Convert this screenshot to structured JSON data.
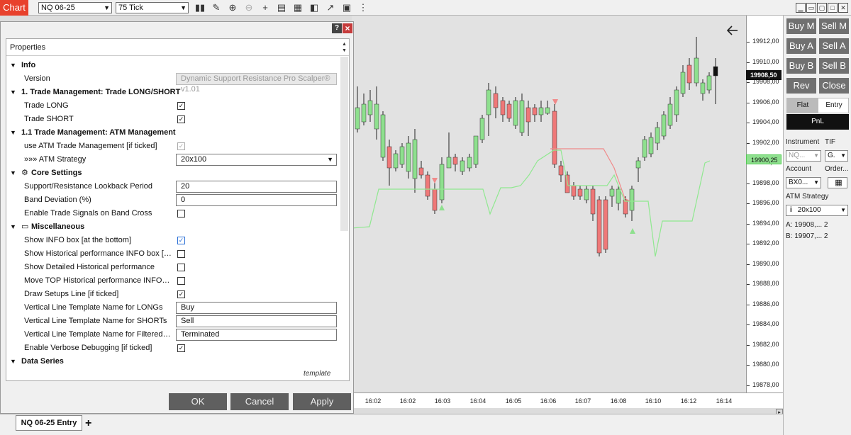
{
  "toolbar": {
    "chart_label": "Chart",
    "instrument": "NQ 06-25",
    "interval": "75 Tick"
  },
  "chart": {
    "price_label": "19908,50",
    "atm_price_label": "19900,25",
    "y_ticks": [
      "19912,00",
      "19910,00",
      "19908,00",
      "19906,00",
      "19904,00",
      "19902,00",
      "19900,00",
      "19898,00",
      "19896,00",
      "19894,00",
      "19892,00",
      "19890,00",
      "19888,00",
      "19886,00",
      "19884,00",
      "19882,00",
      "19880,00",
      "19878,00"
    ],
    "x_ticks": [
      "16:02",
      "16:02",
      "16:03",
      "16:04",
      "16:05",
      "16:06",
      "16:07",
      "16:08",
      "16:10",
      "16:12",
      "16:14"
    ],
    "colors": {
      "up": "#8ee08e",
      "down": "#ef7878",
      "support": "#90e890",
      "resistance": "#f08a8a"
    }
  },
  "right_panel": {
    "buy_mkt": "Buy M",
    "sell_mkt": "Sell M",
    "buy_ask": "Buy A",
    "sell_ask": "Sell A",
    "buy_bid": "Buy B",
    "sell_bid": "Sell B",
    "rev": "Rev",
    "close": "Close",
    "flat": "Flat",
    "entry": "Entry",
    "pnl": "PnL",
    "instrument_label": "Instrument",
    "tif_label": "TIF",
    "instrument_value": "NQ...",
    "tif_value": "G.",
    "account_label": "Account",
    "order_label": "Order...",
    "account_value": "BX0...",
    "atm_label": "ATM Strategy",
    "atm_value": "20x100",
    "ask_line": "A:  19908,...  2",
    "bid_line": "B:  19907,...  2"
  },
  "dialog": {
    "properties_header": "Properties",
    "template_label": "template",
    "ok": "OK",
    "cancel": "Cancel",
    "apply": "Apply",
    "help": "?",
    "rows": [
      {
        "type": "cat",
        "label": "Info"
      },
      {
        "type": "text",
        "label": "Version",
        "value": "Dynamic Support Resistance Pro Scalper® v1.01",
        "disabled": true
      },
      {
        "type": "cat",
        "label": "1. Trade Management: Trade LONG/SHORT"
      },
      {
        "type": "check",
        "label": "Trade LONG",
        "checked": true
      },
      {
        "type": "check",
        "label": "Trade SHORT",
        "checked": true
      },
      {
        "type": "cat",
        "label": "1.1 Trade Management: ATM Management"
      },
      {
        "type": "check",
        "label": "use ATM Trade Management [if ticked]",
        "checked": true,
        "disabled": true
      },
      {
        "type": "select",
        "label": "»»» ATM Strategy",
        "value": "20x100"
      },
      {
        "type": "cat",
        "label": "Core Settings",
        "icon": "gear"
      },
      {
        "type": "text",
        "label": "Support/Resistance Lookback Period",
        "value": "20"
      },
      {
        "type": "text",
        "label": "Band Deviation (%)",
        "value": "0"
      },
      {
        "type": "check",
        "label": "Enable Trade Signals on Band Cross",
        "checked": false
      },
      {
        "type": "cat",
        "label": "Miscellaneous",
        "icon": "misc"
      },
      {
        "type": "check",
        "label": "Show INFO box [at the bottom]",
        "checked": true,
        "blue": true
      },
      {
        "type": "check",
        "label": "Show Historical performance INFO box [at th...",
        "checked": false
      },
      {
        "type": "check",
        "label": "Show Detailed Historical performance",
        "checked": false
      },
      {
        "type": "check",
        "label": "Move TOP Historical performance INFO box",
        "checked": false
      },
      {
        "type": "check",
        "label": "Draw Setups Line [if ticked]",
        "checked": true
      },
      {
        "type": "text",
        "label": "Vertical Line Template Name for LONGs",
        "value": "Buy"
      },
      {
        "type": "text",
        "label": "Vertical Line Template Name for SHORTs",
        "value": "Sell"
      },
      {
        "type": "text",
        "label": "Vertical Line Template Name for Filtered Setu...",
        "value": "Terminated"
      },
      {
        "type": "check",
        "label": "Enable Verbose Debugging [if ticked]",
        "checked": true
      },
      {
        "type": "cat",
        "label": "Data Series"
      }
    ]
  },
  "tabs": {
    "entry_tab": "NQ 06-25 Entry",
    "add": "+"
  }
}
